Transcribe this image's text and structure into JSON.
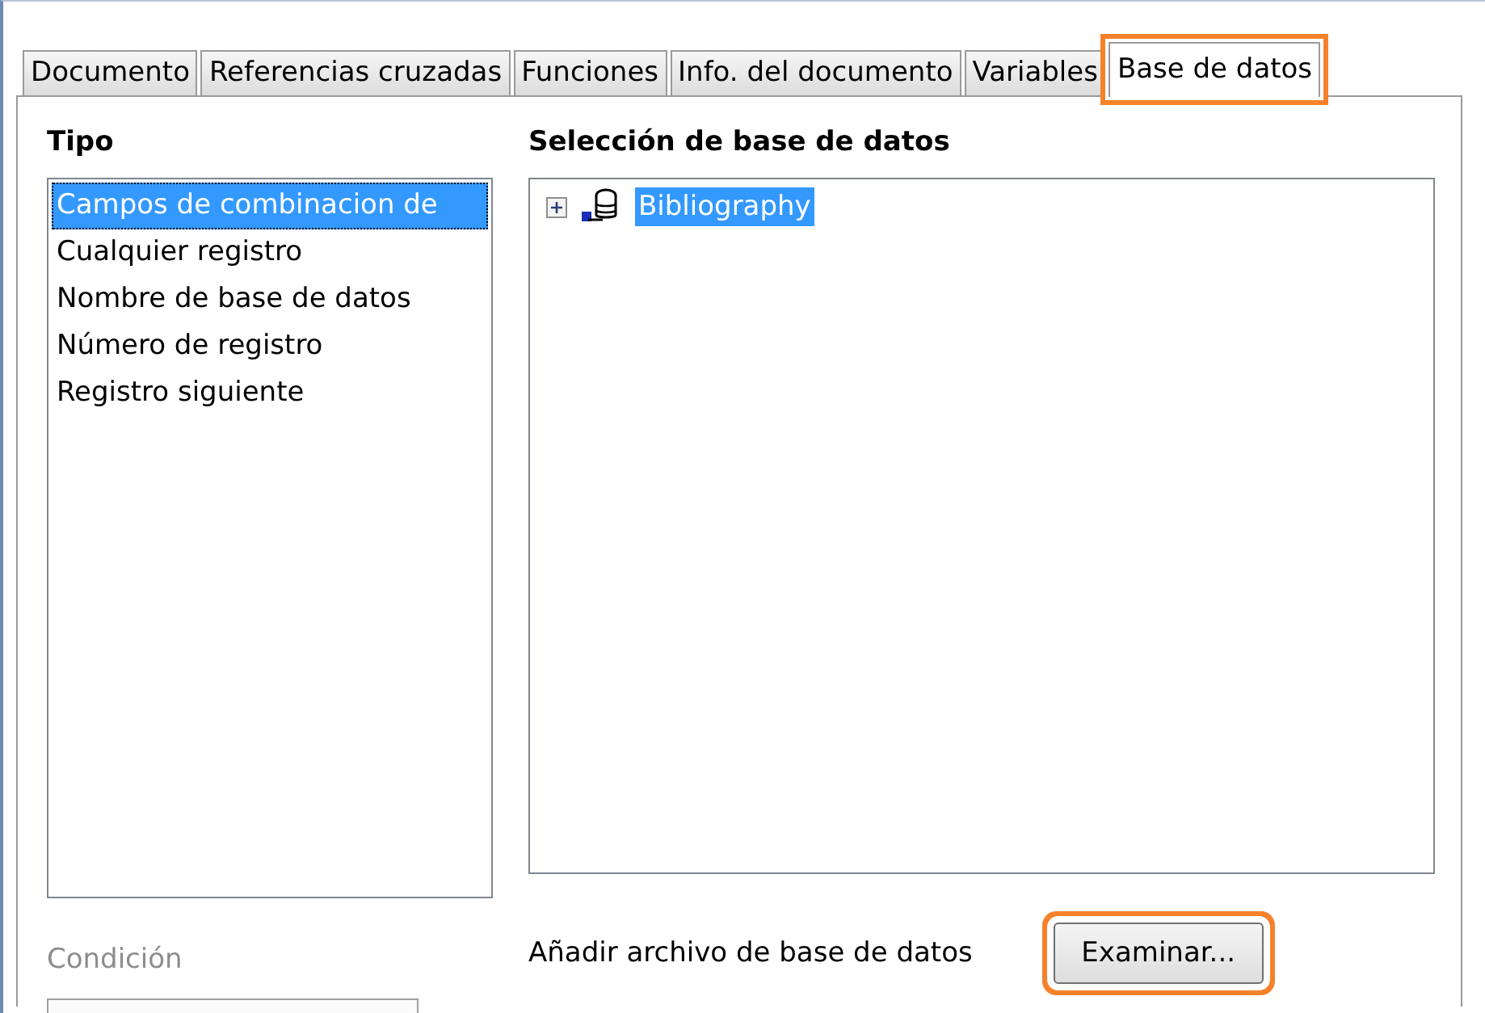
{
  "tabs": [
    {
      "label": "Documento",
      "selected": false,
      "highlighted": false
    },
    {
      "label": "Referencias cruzadas",
      "selected": false,
      "highlighted": false
    },
    {
      "label": "Funciones",
      "selected": false,
      "highlighted": false
    },
    {
      "label": "Info. del documento",
      "selected": false,
      "highlighted": false
    },
    {
      "label": "Variables",
      "selected": false,
      "highlighted": false
    },
    {
      "label": "Base de datos",
      "selected": true,
      "highlighted": true
    }
  ],
  "type_list": {
    "label": "Tipo",
    "items": [
      {
        "label": "Campos de combinacion de",
        "selected": true
      },
      {
        "label": "Cualquier registro",
        "selected": false
      },
      {
        "label": "Nombre de base de datos",
        "selected": false
      },
      {
        "label": "Número de registro",
        "selected": false
      },
      {
        "label": "Registro siguiente",
        "selected": false
      }
    ]
  },
  "database_tree": {
    "label": "Selección de base de datos",
    "items": [
      {
        "label": "Bibliography",
        "expanded": false,
        "selected": true
      }
    ]
  },
  "condition": {
    "label": "Condición",
    "disabled": true
  },
  "add_file": {
    "label": "Añadir archivo de base de datos",
    "button": {
      "label": "Examinar...",
      "highlighted": true
    }
  }
}
